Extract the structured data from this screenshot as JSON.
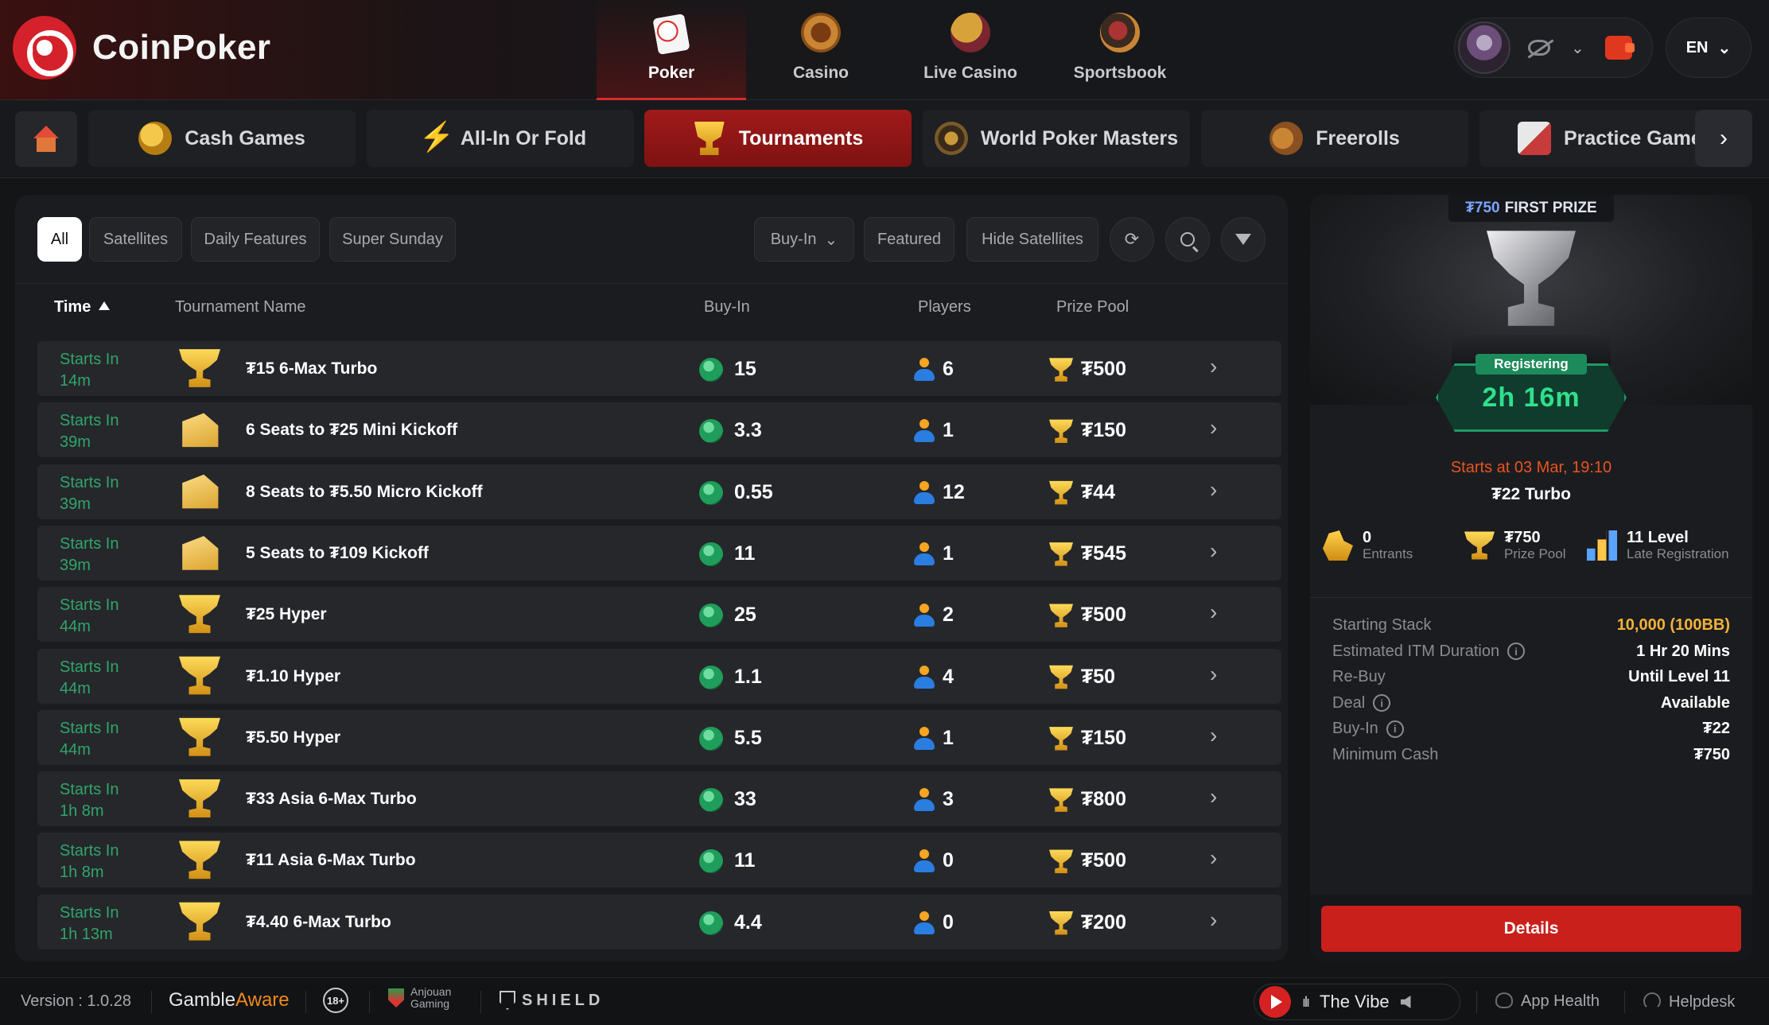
{
  "brand": {
    "name": "CoinPoker"
  },
  "main_nav": [
    {
      "label": "Poker",
      "icon": "poker-cards-icon",
      "active": true
    },
    {
      "label": "Casino",
      "icon": "roulette-icon",
      "active": false
    },
    {
      "label": "Live Casino",
      "icon": "live-casino-icon",
      "active": false
    },
    {
      "label": "Sportsbook",
      "icon": "sportsbook-icon",
      "active": false
    }
  ],
  "account": {
    "avatar": "wolf-avatar",
    "balance_visibility": "hidden"
  },
  "language": {
    "code": "EN"
  },
  "category_tabs": [
    {
      "label": "Cash Games",
      "icon": "coins-icon",
      "active": false
    },
    {
      "label": "All-In Or Fold",
      "icon": "lightning-icon",
      "active": false
    },
    {
      "label": "Tournaments",
      "icon": "trophy-icon",
      "active": true
    },
    {
      "label": "World Poker Masters",
      "icon": "wpm-emblem-icon",
      "active": false
    },
    {
      "label": "Freerolls",
      "icon": "freeroll-bag-icon",
      "active": false
    },
    {
      "label": "Practice Game",
      "icon": "practice-cards-icon",
      "active": false
    }
  ],
  "filters": {
    "chips": [
      {
        "label": "All",
        "active": true
      },
      {
        "label": "Satellites",
        "active": false
      },
      {
        "label": "Daily Features",
        "active": false
      },
      {
        "label": "Super Sunday",
        "active": false
      }
    ],
    "buyin_dropdown": "Buy-In",
    "featured": "Featured",
    "hide_satellites": "Hide Satellites"
  },
  "table": {
    "columns": {
      "time": "Time",
      "name": "Tournament Name",
      "buyin": "Buy-In",
      "players": "Players",
      "prize_pool": "Prize Pool"
    },
    "sort": {
      "column": "time",
      "direction": "ascending"
    },
    "rows": [
      {
        "starts_label": "Starts In",
        "starts_time": "14m",
        "type": "trophy",
        "name": "₮15 6-Max Turbo",
        "buyin": "15",
        "players": "6",
        "prize": "₮500"
      },
      {
        "starts_label": "Starts In",
        "starts_time": "39m",
        "type": "ticket",
        "name": "6 Seats to ₮25 Mini Kickoff",
        "buyin": "3.3",
        "players": "1",
        "prize": "₮150"
      },
      {
        "starts_label": "Starts In",
        "starts_time": "39m",
        "type": "ticket",
        "name": "8 Seats to ₮5.50 Micro Kickoff",
        "buyin": "0.55",
        "players": "12",
        "prize": "₮44"
      },
      {
        "starts_label": "Starts In",
        "starts_time": "39m",
        "type": "ticket",
        "name": "5 Seats to ₮109 Kickoff",
        "buyin": "11",
        "players": "1",
        "prize": "₮545"
      },
      {
        "starts_label": "Starts In",
        "starts_time": "44m",
        "type": "trophy",
        "name": "₮25 Hyper",
        "buyin": "25",
        "players": "2",
        "prize": "₮500"
      },
      {
        "starts_label": "Starts In",
        "starts_time": "44m",
        "type": "trophy",
        "name": "₮1.10 Hyper",
        "buyin": "1.1",
        "players": "4",
        "prize": "₮50"
      },
      {
        "starts_label": "Starts In",
        "starts_time": "44m",
        "type": "trophy",
        "name": "₮5.50 Hyper",
        "buyin": "5.5",
        "players": "1",
        "prize": "₮150"
      },
      {
        "starts_label": "Starts In",
        "starts_time": "1h 8m",
        "type": "trophy",
        "name": "₮33 Asia 6-Max Turbo",
        "buyin": "33",
        "players": "3",
        "prize": "₮800"
      },
      {
        "starts_label": "Starts In",
        "starts_time": "1h 8m",
        "type": "trophy",
        "name": "₮11 Asia 6-Max Turbo",
        "buyin": "11",
        "players": "0",
        "prize": "₮500"
      },
      {
        "starts_label": "Starts In",
        "starts_time": "1h 13m",
        "type": "trophy",
        "name": "₮4.40 6-Max Turbo",
        "buyin": "4.4",
        "players": "0",
        "prize": "₮200"
      }
    ]
  },
  "detail": {
    "first_prize_amount": "₮750",
    "first_prize_label": "FIRST PRIZE",
    "status": "Registering",
    "countdown": "2h 16m",
    "starts_at": "Starts at 03 Mar, 19:10",
    "title": "₮22 Turbo",
    "stats": {
      "entrants": {
        "value": "0",
        "label": "Entrants"
      },
      "prize_pool": {
        "value": "₮750",
        "label": "Prize Pool"
      },
      "late_reg": {
        "value": "11 Level",
        "label": "Late Registration"
      }
    },
    "info": [
      {
        "label": "Starting Stack",
        "value": "10,000 (100BB)",
        "info_icon": false,
        "highlight": true
      },
      {
        "label": "Estimated ITM Duration",
        "value": "1 Hr 20 Mins",
        "info_icon": true,
        "highlight": false
      },
      {
        "label": "Re-Buy",
        "value": "Until Level 11",
        "info_icon": false,
        "highlight": false
      },
      {
        "label": "Deal",
        "value": "Available",
        "info_icon": true,
        "highlight": false
      },
      {
        "label": "Buy-In",
        "value": "₮22",
        "info_icon": true,
        "highlight": false
      },
      {
        "label": "Minimum Cash",
        "value": "₮750",
        "info_icon": false,
        "highlight": false
      }
    ],
    "details_button": "Details"
  },
  "footer": {
    "version": "Version : 1.0.28",
    "gamble_aware_part1": "Gamble",
    "gamble_aware_part2": "Aware",
    "age_badge": "18+",
    "anjouan_line1": "Anjouan",
    "anjouan_line2": "Gaming",
    "shield": "SHIELD",
    "player": {
      "track": "The Vibe"
    },
    "app_health": "App Health",
    "helpdesk": "Helpdesk"
  },
  "colors": {
    "accent_red": "#c9201c",
    "starts_green": "#2fa56b",
    "gold": "#f0b33a",
    "starts_at_orange": "#e8551f"
  }
}
